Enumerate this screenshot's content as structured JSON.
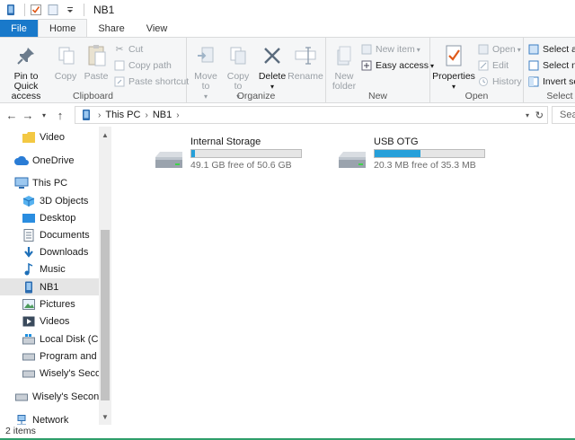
{
  "window": {
    "title": "NB1"
  },
  "tabs": [
    {
      "label": "File"
    },
    {
      "label": "Home"
    },
    {
      "label": "Share"
    },
    {
      "label": "View"
    }
  ],
  "ribbon": {
    "clipboard": {
      "label": "Clipboard",
      "pin": "Pin to Quick access",
      "copy": "Copy",
      "paste": "Paste",
      "cut": "Cut",
      "copy_path": "Copy path",
      "paste_shortcut": "Paste shortcut"
    },
    "organize": {
      "label": "Organize",
      "move_to": "Move to",
      "copy_to": "Copy to",
      "delete": "Delete",
      "rename": "Rename"
    },
    "new": {
      "label": "New",
      "new_folder": "New folder",
      "new_item": "New item",
      "easy_access": "Easy access"
    },
    "open": {
      "label": "Open",
      "properties": "Properties",
      "open": "Open",
      "edit": "Edit",
      "history": "History"
    },
    "select": {
      "label": "Select",
      "select_all": "Select all",
      "select_none": "Select none",
      "invert": "Invert selection"
    }
  },
  "address": {
    "crumbs": [
      "This PC",
      "NB1"
    ],
    "search_placeholder": "Sea"
  },
  "nav": {
    "items": [
      {
        "label": "Video",
        "icon": "folder-icon"
      },
      {
        "label": "OneDrive",
        "icon": "cloud-icon"
      },
      {
        "label": "This PC",
        "icon": "computer-icon"
      },
      {
        "label": "3D Objects",
        "icon": "cube-icon"
      },
      {
        "label": "Desktop",
        "icon": "desktop-icon"
      },
      {
        "label": "Documents",
        "icon": "document-icon"
      },
      {
        "label": "Downloads",
        "icon": "download-icon"
      },
      {
        "label": "Music",
        "icon": "music-icon"
      },
      {
        "label": "NB1",
        "icon": "phone-icon"
      },
      {
        "label": "Pictures",
        "icon": "pictures-icon"
      },
      {
        "label": "Videos",
        "icon": "video-icon"
      },
      {
        "label": "Local Disk (C:)",
        "icon": "disk-icon"
      },
      {
        "label": "Program and Ga",
        "icon": "disk-icon"
      },
      {
        "label": "Wisely's Second",
        "icon": "disk-icon"
      },
      {
        "label": "Wisely's Second H",
        "icon": "disk-icon"
      },
      {
        "label": "Network",
        "icon": "network-icon"
      }
    ]
  },
  "drives": [
    {
      "name": "Internal Storage",
      "info": "49.1 GB free of 50.6 GB",
      "used_fraction": 0.03
    },
    {
      "name": "USB OTG",
      "info": "20.3 MB free of 35.3 MB",
      "used_fraction": 0.42
    }
  ],
  "status": {
    "items": "2 items"
  },
  "colors": {
    "accent": "#1979ca",
    "progress": "#26a0da",
    "selected": "#e5e5e5"
  }
}
